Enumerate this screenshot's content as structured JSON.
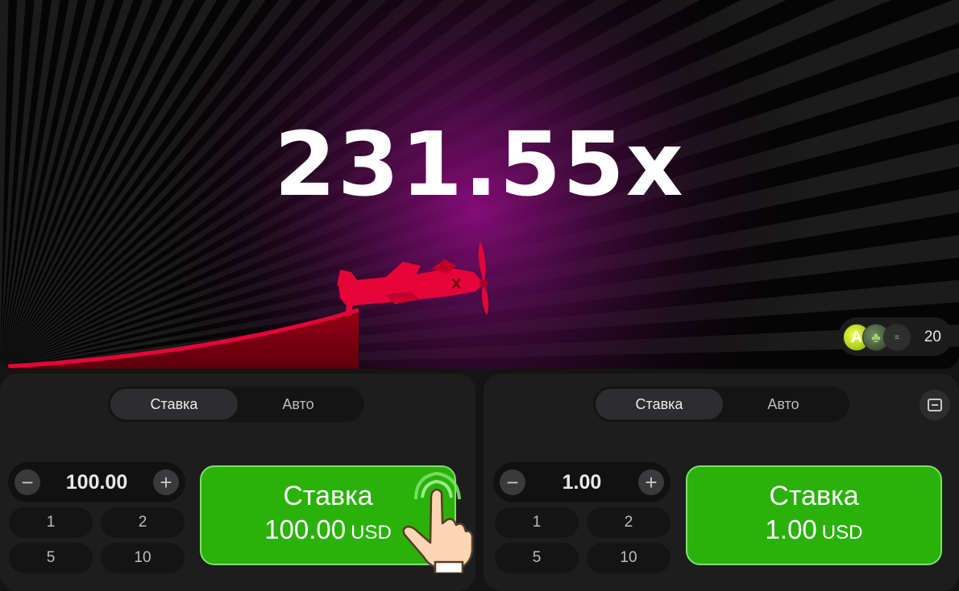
{
  "game": {
    "multiplier": "231.55x",
    "players_count": "20",
    "accent_color": "#e50539",
    "glow_color": "#8a0c7d"
  },
  "panels": [
    {
      "tabs": [
        "Ставка",
        "Авто"
      ],
      "active_tab": "Ставка",
      "amount": "100.00",
      "quick_amounts": [
        "1",
        "2",
        "5",
        "10"
      ],
      "bet_button": {
        "label": "Ставка",
        "amount": "100.00",
        "currency": "USD"
      }
    },
    {
      "tabs": [
        "Ставка",
        "Авто"
      ],
      "active_tab": "Ставка",
      "amount": "1.00",
      "quick_amounts": [
        "1",
        "2",
        "5",
        "10"
      ],
      "bet_button": {
        "label": "Ставка",
        "amount": "1.00",
        "currency": "USD"
      }
    }
  ],
  "steppers": {
    "minus": "−",
    "plus": "+"
  },
  "icons": [
    "airplane-icon",
    "minus-icon",
    "plus-icon",
    "collapse-icon",
    "tap-hand-icon"
  ],
  "colors": {
    "bet_green": "#2ab20b",
    "panel": "#1d1d1e"
  }
}
